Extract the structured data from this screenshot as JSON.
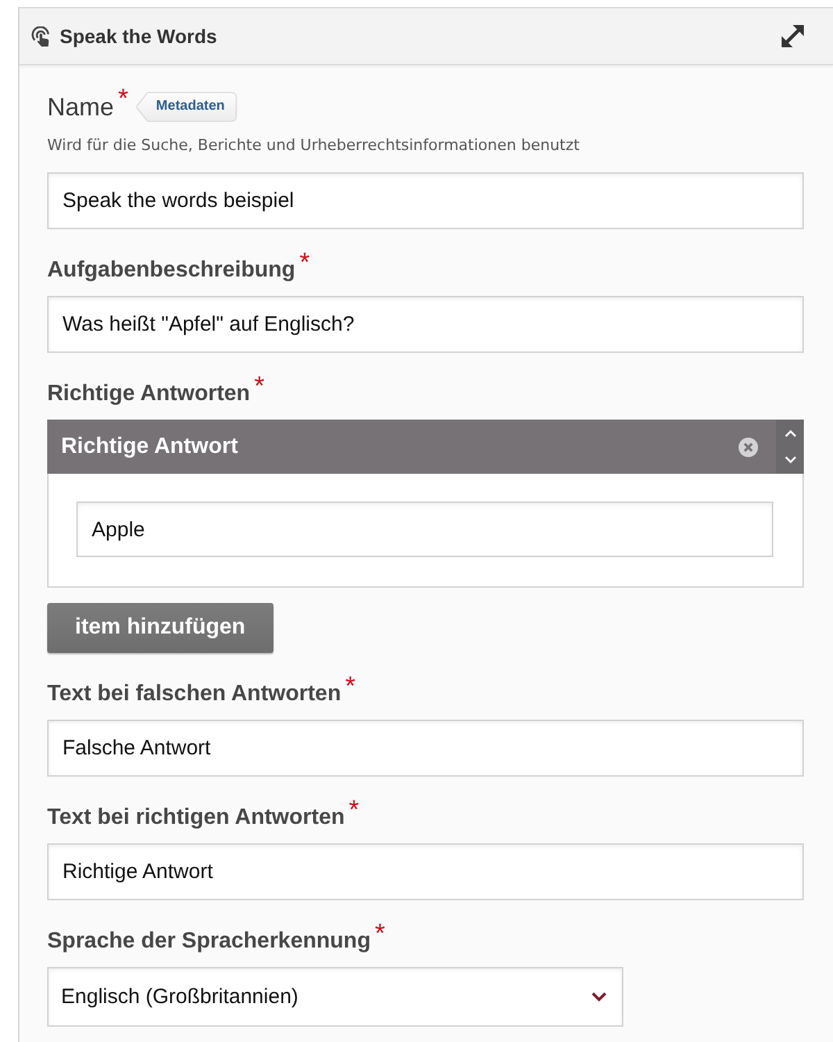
{
  "panel": {
    "title": "Speak the Words",
    "fields": [
      {
        "kind": "text",
        "label": "Name",
        "required_mark": "*",
        "tag": "Metadaten",
        "description": "Wird für die Suche, Berichte und Urheberrechtsinformationen benutzt",
        "value": "Speak the words beispiel"
      },
      {
        "kind": "text",
        "label": "Aufgabenbeschreibung",
        "required_mark": "*",
        "value": "Was heißt \"Apfel\" auf Englisch?"
      },
      {
        "kind": "list",
        "label": "Richtige Antworten",
        "required_mark": "*",
        "items": [
          {
            "title": "Richtige Antwort",
            "value": "Apple"
          }
        ],
        "add_button": "item hinzufügen"
      },
      {
        "kind": "text",
        "label": "Text bei falschen Antworten",
        "required_mark": "*",
        "value": "Falsche Antwort"
      },
      {
        "kind": "text",
        "label": "Text bei richtigen Antworten",
        "required_mark": "*",
        "value": "Richtige Antwort"
      },
      {
        "kind": "select",
        "label": "Sprache der Spracherkennung",
        "required_mark": "*",
        "value": "Englisch (Großbritannien)"
      }
    ]
  }
}
